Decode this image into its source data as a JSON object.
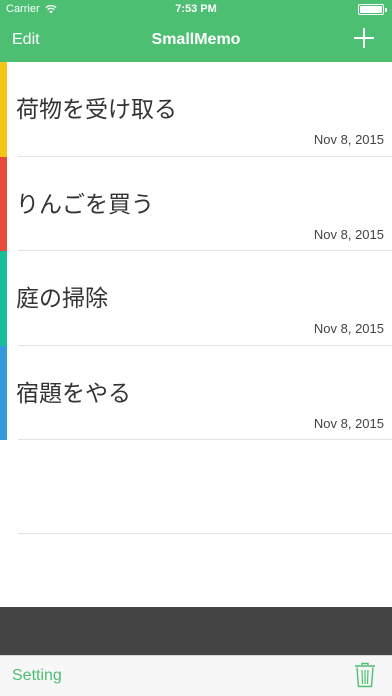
{
  "status_bar": {
    "carrier": "Carrier",
    "time": "7:53 PM",
    "wifi_icon": "wifi-icon",
    "battery_icon": "battery-icon",
    "battery_level": 1.0
  },
  "nav": {
    "edit_label": "Edit",
    "title": "SmallMemo",
    "add_icon": "plus-icon"
  },
  "memos": [
    {
      "title": "荷物を受け取る",
      "date": "Nov 8, 2015",
      "color": "#f5c518"
    },
    {
      "title": "りんごを買う",
      "date": "Nov 8, 2015",
      "color": "#e84c3d"
    },
    {
      "title": "庭の掃除",
      "date": "Nov 8, 2015",
      "color": "#1abc9c"
    },
    {
      "title": "宿題をやる",
      "date": "Nov 8, 2015",
      "color": "#3498db"
    }
  ],
  "toolbar": {
    "setting_label": "Setting",
    "trash_icon": "trash-icon"
  },
  "colors": {
    "accent": "#4cbf73",
    "dark_strip": "#444444"
  }
}
